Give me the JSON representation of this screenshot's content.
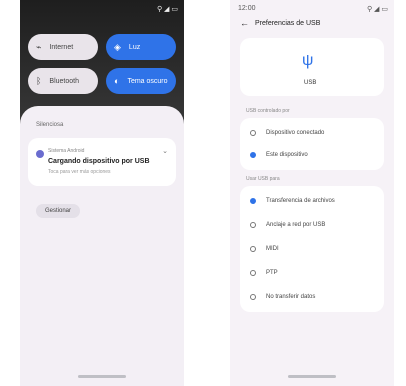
{
  "left_phone": {
    "status_icons": "⚲ ◢ ▭",
    "quick_settings": [
      {
        "label": "Internet",
        "icon": "wifi-icon"
      },
      {
        "label": "Bluetooth",
        "icon": "bluetooth-icon"
      },
      {
        "label": "Luz",
        "icon": "flashlight-icon"
      },
      {
        "label": "Tema oscuro",
        "icon": "dark-mode-icon"
      }
    ],
    "notifications": {
      "header": "Silenciosa",
      "card": {
        "app": "Sistema Android",
        "title": "Cargando dispositivo por USB",
        "subtitle": "Toca para ver más opciones"
      },
      "manage_label": "Gestionar"
    }
  },
  "right_phone": {
    "time": "12:00",
    "status_icons": "⚲ ◢ ▭",
    "title": "Preferencias de USB",
    "usb_label": "USB",
    "section1_title": "USB controlado por",
    "section1_options": [
      {
        "label": "Dispositivo conectado",
        "selected": false
      },
      {
        "label": "Este dispositivo",
        "selected": true
      }
    ],
    "section2_title": "Usar USB para",
    "section2_options": [
      {
        "label": "Transferencia de archivos",
        "selected": true
      },
      {
        "label": "Anclaje a red por USB",
        "selected": false
      },
      {
        "label": "MIDI",
        "selected": false
      },
      {
        "label": "PTP",
        "selected": false
      },
      {
        "label": "No transferir datos",
        "selected": false
      }
    ]
  }
}
